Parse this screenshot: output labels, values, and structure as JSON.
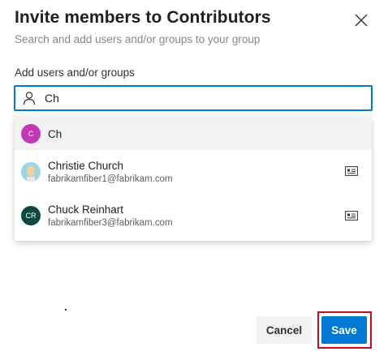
{
  "dialog": {
    "title": "Invite members to Contributors",
    "subtitle": "Search and add users and/or groups to your group",
    "close_icon": "close-icon"
  },
  "search": {
    "label": "Add users and/or groups",
    "value": "Ch",
    "icon": "person-icon"
  },
  "suggestions": [
    {
      "initials": "C",
      "name": "Ch",
      "email": "",
      "avatar_color": "#c239b3"
    },
    {
      "initials": "",
      "name": "Christie Church",
      "email": "fabrikamfiber1@fabrikam.com",
      "avatar_color": "#9fd3e6"
    },
    {
      "initials": "CR",
      "name": "Chuck Reinhart",
      "email": "fabrikamfiber3@fabrikam.com",
      "avatar_color": "#0b4a3f"
    }
  ],
  "footer": {
    "cancel_label": "Cancel",
    "save_label": "Save"
  },
  "colors": {
    "accent": "#0078d4",
    "highlight_border": "#c50f1f"
  }
}
